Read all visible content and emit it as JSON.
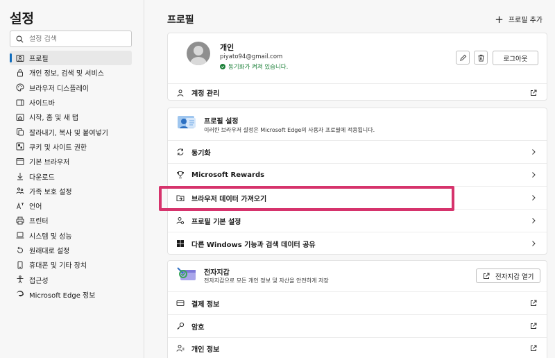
{
  "sidebar": {
    "title": "설정",
    "search_placeholder": "설정 검색",
    "items": [
      {
        "label": "프로필",
        "icon": "profile-icon",
        "active": true
      },
      {
        "label": "개인 정보, 검색 및 서비스",
        "icon": "lock-icon"
      },
      {
        "label": "브라우저 디스플레이",
        "icon": "palette-icon"
      },
      {
        "label": "사이드바",
        "icon": "sidebar-icon"
      },
      {
        "label": "시작, 홈 및 새 탭",
        "icon": "home-tab-icon"
      },
      {
        "label": "잘라내기, 복사 및 붙여넣기",
        "icon": "clipboard-icon"
      },
      {
        "label": "쿠키 및 사이트 권한",
        "icon": "cookie-icon"
      },
      {
        "label": "기본 브라우저",
        "icon": "browser-icon"
      },
      {
        "label": "다운로드",
        "icon": "download-icon"
      },
      {
        "label": "가족 보호 설정",
        "icon": "family-icon"
      },
      {
        "label": "언어",
        "icon": "language-icon"
      },
      {
        "label": "프린터",
        "icon": "printer-icon"
      },
      {
        "label": "시스템 및 성능",
        "icon": "laptop-icon"
      },
      {
        "label": "원래대로 설정",
        "icon": "reset-icon"
      },
      {
        "label": "휴대폰 및 기타 장치",
        "icon": "phone-icon"
      },
      {
        "label": "접근성",
        "icon": "accessibility-icon"
      },
      {
        "label": "Microsoft Edge 정보",
        "icon": "edge-icon"
      }
    ]
  },
  "main": {
    "title": "프로필",
    "add_profile": "프로필 추가",
    "profile": {
      "name": "개인",
      "email": "piyato94@gmail.com",
      "sync_status": "동기화가 켜져 있습니다.",
      "logout": "로그아웃",
      "manage_account": "계정 관리"
    },
    "settings": {
      "title": "프로필 설정",
      "description": "이러한 브라우저 설정은 Microsoft Edge의 사용자 프로필에 적용됩니다.",
      "rows": [
        {
          "label": "동기화",
          "icon": "sync-icon"
        },
        {
          "label": "Microsoft Rewards",
          "icon": "trophy-icon"
        },
        {
          "label": "브라우저 데이터 가져오기",
          "icon": "import-folder-icon"
        },
        {
          "label": "프로필 기본 설정",
          "icon": "profile-settings-icon"
        },
        {
          "label": "다른 Windows 기능과 검색 데이터 공유",
          "icon": "windows-icon"
        }
      ]
    },
    "wallet": {
      "title": "전자지갑",
      "description": "전자지갑으로 모든 개인 정보 및 자산을 안전하게 저장",
      "open_button": "전자지갑 열기",
      "rows": [
        {
          "label": "결제 정보",
          "icon": "card-icon"
        },
        {
          "label": "암호",
          "icon": "key-icon"
        },
        {
          "label": "개인 정보",
          "icon": "person-info-icon"
        }
      ]
    }
  },
  "colors": {
    "accent": "#0f6cbd",
    "highlight": "#d6336c",
    "sync_green": "#1a7f37"
  }
}
